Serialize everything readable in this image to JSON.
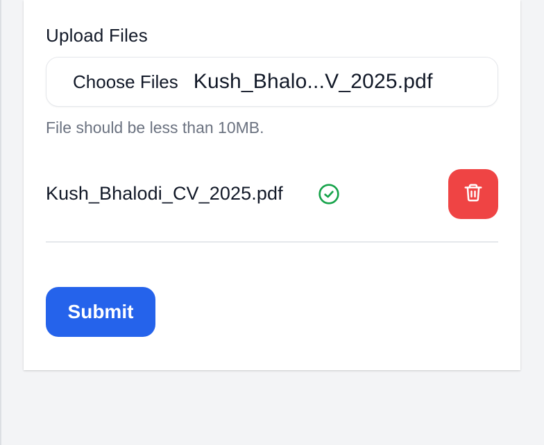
{
  "upload": {
    "label": "Upload Files",
    "choose_button": "Choose Files",
    "chosen_file_display": "Kush_Bhalo...V_2025.pdf",
    "hint": "File should be less than 10MB."
  },
  "files": [
    {
      "name": "Kush_Bhalodi_CV_2025.pdf",
      "status_icon": "check-circle-icon",
      "delete_icon": "trash-icon"
    }
  ],
  "form": {
    "submit_label": "Submit"
  },
  "colors": {
    "primary": "#2563eb",
    "danger": "#ef4444",
    "success": "#16a34a",
    "muted_text": "#6b7280"
  }
}
